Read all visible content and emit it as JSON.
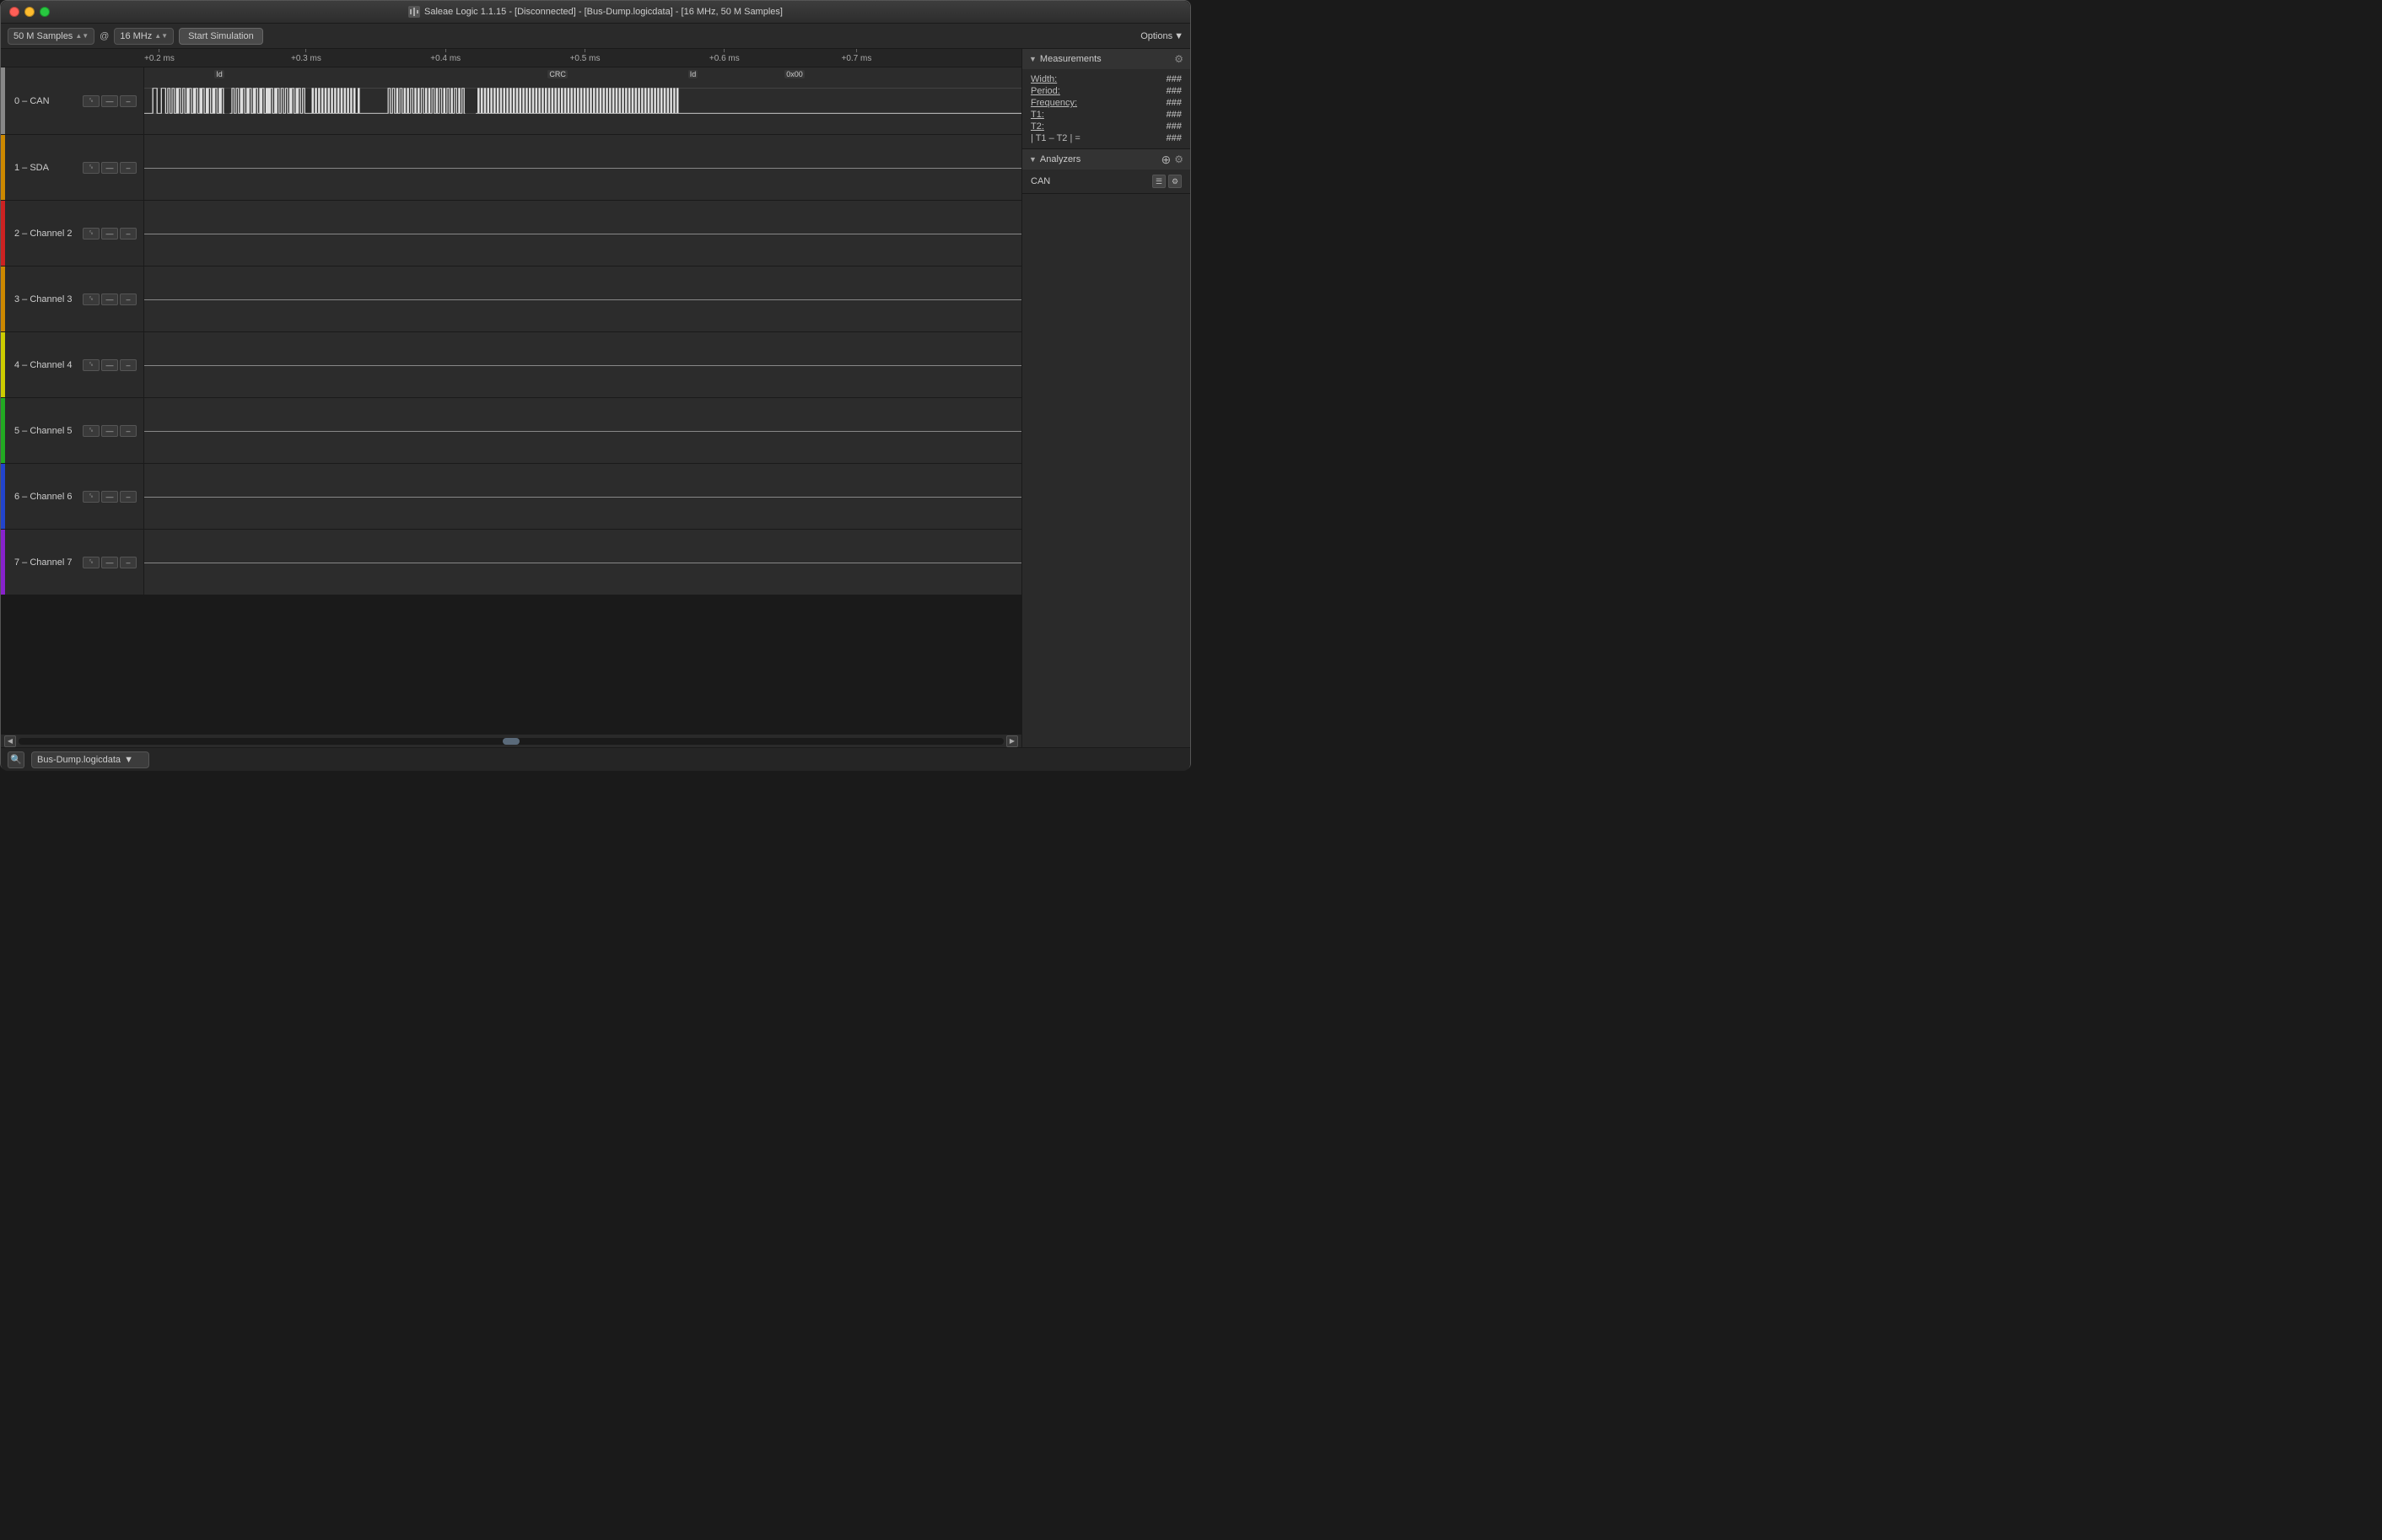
{
  "titleBar": {
    "title": "Saleae Logic 1.1.15 - [Disconnected] - [Bus-Dump.logicdata] - [16 MHz, 50 M Samples]"
  },
  "toolbar": {
    "samplesLabel": "50 M Samples",
    "atSign": "@",
    "freqLabel": "16 MHz",
    "simButton": "Start Simulation",
    "optionsButton": "Options"
  },
  "timeRuler": {
    "marks": [
      {
        "label": "+0.2 ms",
        "position": 0
      },
      {
        "label": "+0.3 ms",
        "position": 20
      },
      {
        "label": "+0.4 ms",
        "position": 39
      },
      {
        "label": "+0.5 ms",
        "position": 58
      },
      {
        "label": "+0.6 ms",
        "position": 77
      },
      {
        "label": "+0.7 ms",
        "position": 96
      }
    ]
  },
  "channels": [
    {
      "id": 0,
      "name": "0 – CAN",
      "color": "#888888",
      "hasWaveform": true,
      "annotations": [
        {
          "label": "Id",
          "left": "8%"
        },
        {
          "label": "CRC",
          "left": "46%"
        },
        {
          "label": "Id",
          "left": "62%"
        },
        {
          "label": "0x00",
          "left": "72%"
        }
      ]
    },
    {
      "id": 1,
      "name": "1 – SDA",
      "color": "#cc8800",
      "hasWaveform": false
    },
    {
      "id": 2,
      "name": "2 – Channel 2",
      "color": "#cc2222",
      "hasWaveform": false
    },
    {
      "id": 3,
      "name": "3 – Channel 3",
      "color": "#cc8800",
      "hasWaveform": false
    },
    {
      "id": 4,
      "name": "4 – Channel 4",
      "color": "#cccc00",
      "hasWaveform": false
    },
    {
      "id": 5,
      "name": "5 – Channel 5",
      "color": "#22aa22",
      "hasWaveform": false
    },
    {
      "id": 6,
      "name": "6 – Channel 6",
      "color": "#2244cc",
      "hasWaveform": false
    },
    {
      "id": 7,
      "name": "7 – Channel 7",
      "color": "#8822cc",
      "hasWaveform": false
    }
  ],
  "measurements": {
    "title": "Measurements",
    "items": [
      {
        "label": "Width:",
        "value": "###"
      },
      {
        "label": "Period:",
        "value": "###"
      },
      {
        "label": "Frequency:",
        "value": "###"
      },
      {
        "label": "T1:",
        "value": "###"
      },
      {
        "label": "T2:",
        "value": "###"
      },
      {
        "label": "| T1 – T2 | =",
        "value": "###"
      }
    ]
  },
  "analyzers": {
    "title": "Analyzers",
    "items": [
      {
        "name": "CAN"
      }
    ]
  },
  "statusBar": {
    "filename": "Bus-Dump.logicdata"
  }
}
